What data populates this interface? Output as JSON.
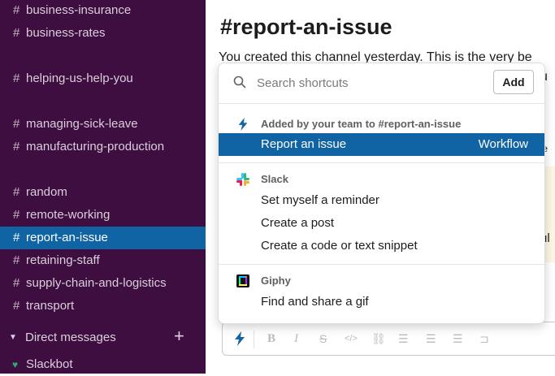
{
  "sidebar": {
    "channels": [
      {
        "label": "business-insurance"
      },
      {
        "label": "business-rates"
      },
      {
        "label": "helping-us-help-you"
      },
      {
        "label": "managing-sick-leave"
      },
      {
        "label": "manufacturing-production"
      },
      {
        "label": "random"
      },
      {
        "label": "remote-working"
      },
      {
        "label": "report-an-issue",
        "active": true
      },
      {
        "label": "retaining-staff"
      },
      {
        "label": "supply-chain-and-logistics"
      },
      {
        "label": "transport"
      }
    ],
    "hash": "#",
    "direct_messages_label": "Direct messages",
    "plus": "+",
    "slackbot_label": "Slackbot",
    "colors": {
      "background": "#3f0e40",
      "active": "#1164a3",
      "presence": "#2bac76"
    }
  },
  "main": {
    "channel_title": "#report-an-issue",
    "intro_text": "You created this channel yesterday. This is the very be",
    "fragment_1": "u",
    "fragment_2": "te",
    "fragment_3": "ul"
  },
  "composer": {
    "icons": [
      "bolt-icon",
      "bold-icon",
      "italic-icon",
      "strikethrough-icon",
      "code-icon",
      "link-icon",
      "ordered-list-icon",
      "bulleted-list-icon",
      "indent-icon",
      "code-block-icon"
    ]
  },
  "shortcuts": {
    "search_placeholder": "Search shortcuts",
    "add_button": "Add",
    "sections": [
      {
        "title": "Added by your team to #report-an-issue",
        "icon": "bolt-icon",
        "items": [
          {
            "label": "Report an issue",
            "right": "Workflow",
            "highlighted": true
          }
        ]
      },
      {
        "title": "Slack",
        "icon": "slack-logo-icon",
        "items": [
          {
            "label": "Set myself a reminder"
          },
          {
            "label": "Create a post"
          },
          {
            "label": "Create a code or text snippet"
          }
        ]
      },
      {
        "title": "Giphy",
        "icon": "giphy-logo-icon",
        "items": [
          {
            "label": "Find and share a gif"
          }
        ]
      }
    ],
    "colors": {
      "highlight": "#1164a3",
      "bolt": "#1264a3"
    }
  }
}
